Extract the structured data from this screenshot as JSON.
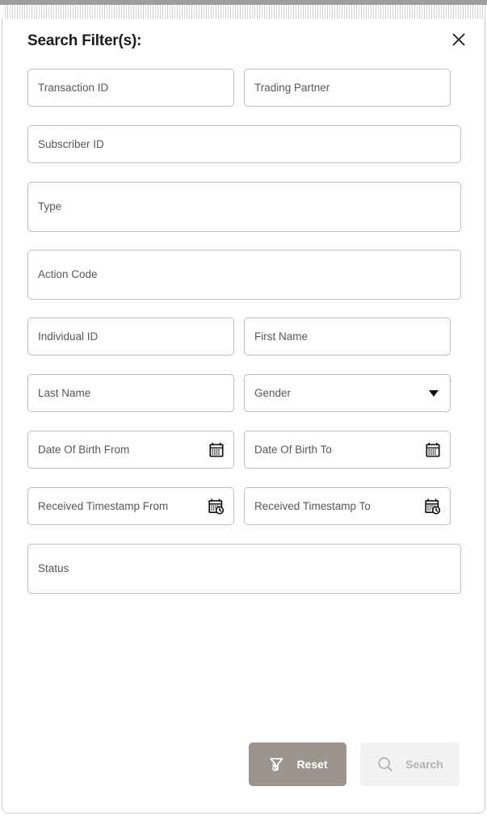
{
  "dialog": {
    "title": "Search Filter(s):",
    "close_icon": "close-icon"
  },
  "fields": {
    "transaction_id": "Transaction ID",
    "trading_partner": "Trading Partner",
    "subscriber_id": "Subscriber ID",
    "type": "Type",
    "action_code": "Action Code",
    "individual_id": "Individual ID",
    "first_name": "First Name",
    "last_name": "Last Name",
    "gender": "Gender",
    "date_of_birth_from": "Date Of Birth From",
    "date_of_birth_to": "Date Of Birth To",
    "received_timestamp_from": "Received Timestamp From",
    "received_timestamp_to": "Received Timestamp To",
    "status": "Status"
  },
  "icons": {
    "gender_caret": "chevron-down-icon",
    "calendar": "calendar-icon",
    "calendar_clock": "calendar-clock-icon",
    "reset": "filter-reset-icon",
    "search": "search-icon"
  },
  "footer": {
    "reset_label": "Reset",
    "search_label": "Search"
  },
  "colors": {
    "reset_button_bg": "#9c958f",
    "reset_button_text": "#ffffff",
    "search_button_bg": "#f2f2f2",
    "search_button_text": "#b2b2b2",
    "field_border": "#bdbdbd",
    "placeholder_text": "#56585c",
    "title_text": "#1c1c1c"
  }
}
